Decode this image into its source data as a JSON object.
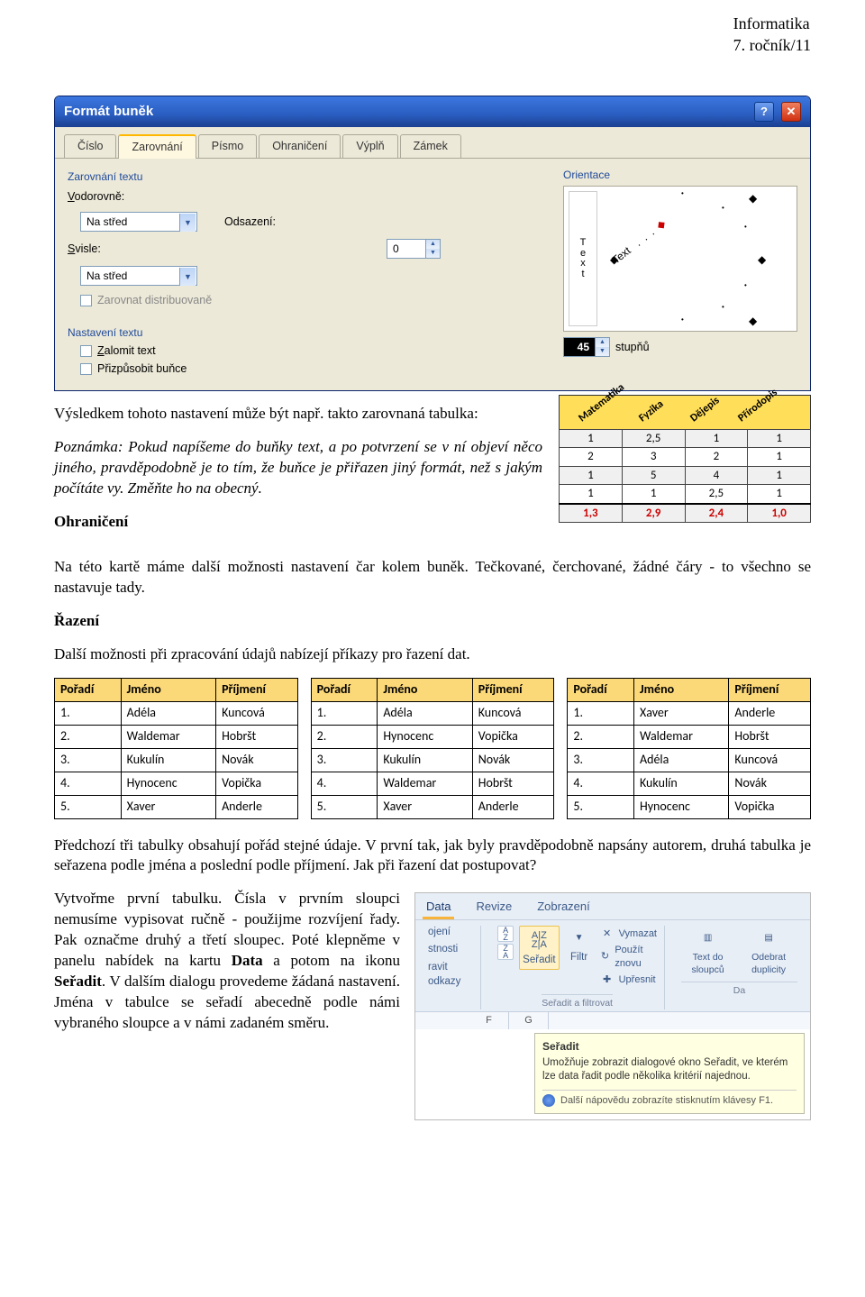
{
  "header": {
    "line1": "Informatika",
    "line2": "7. ročník/11"
  },
  "dialog": {
    "title": "Formát buněk",
    "tabs": [
      "Číslo",
      "Zarovnání",
      "Písmo",
      "Ohraničení",
      "Výplň",
      "Zámek"
    ],
    "active_tab": 1,
    "groups": {
      "align": {
        "title": "Zarovnání textu",
        "horiz_label": "Vodorovně:",
        "horiz_value": "Na střed",
        "indent_label": "Odsazení:",
        "indent_value": "0",
        "vert_label": "Svisle:",
        "vert_value": "Na střed",
        "distrib_label": "Zarovnat distribuovaně"
      },
      "textctl": {
        "title": "Nastavení textu",
        "wrap_label": "Zalomit text",
        "shrink_label": "Přizpůsobit buňce"
      },
      "orient": {
        "title": "Orientace",
        "vtext": "T e x t",
        "dial_label": "Text",
        "degrees": "45",
        "deg_unit": "stupňů"
      }
    }
  },
  "body": {
    "p1a": "Výsledkem tohoto nastavení může být např. takto zarovnaná tabulka:",
    "note_label": "Poznámka:",
    "note": " Pokud napíšeme do buňky text, a po potvrzení se v ní objeví něco jiného, pravděpodobně je to tím, že buňce je přiřazen jiný formát, než s jakým počítáte vy. Změňte ho na obecný.",
    "h_ohraniceni": "Ohraničení",
    "p2": "Na této kartě máme další možnosti nastavení čar kolem buněk. Tečkované, čerchované, žádné čáry - to všechno se nastavuje tady.",
    "h_razeni": "Řazení",
    "p3": "Další možnosti při zpracování údajů nabízejí příkazy pro řazení dat.",
    "p4": "Předchozí tři tabulky obsahují pořád stejné údaje. V první tak, jak byly pravděpodobně napsány autorem, druhá tabulka je seřazena podle jména a poslední podle příjmení. Jak při řazení dat postupovat?",
    "p5a": "Vytvořme první tabulku. Čísla v prvním sloupci nemusíme vypisovat ručně - použijme rozvíjení řady. Pak označme druhý a třetí sloupec. Poté klepněme v panelu nabídek na kartu ",
    "p5b": "Data",
    "p5c": " a potom na ikonu ",
    "p5d": "Seřadit",
    "p5e": ". V dalším dialogu provedeme žádaná nastavení. Jména v tabulce se seřadí abecedně podle námi vybraného sloupce a v námi zadaném směru."
  },
  "grades": {
    "subjects": [
      "Matematika",
      "Fyzika",
      "Dějepis",
      "Přírodopis"
    ],
    "rows": [
      [
        "1",
        "2,5",
        "1",
        "1"
      ],
      [
        "2",
        "3",
        "2",
        "1"
      ],
      [
        "1",
        "5",
        "4",
        "1"
      ],
      [
        "1",
        "1",
        "2,5",
        "1"
      ],
      [
        "1,3",
        "2,9",
        "2,4",
        "1,0"
      ]
    ]
  },
  "names_tables": {
    "headers": [
      "Pořadí",
      "Jméno",
      "Příjmení"
    ],
    "t1": [
      [
        "1.",
        "Adéla",
        "Kuncová"
      ],
      [
        "2.",
        "Waldemar",
        "Hobršt"
      ],
      [
        "3.",
        "Kukulín",
        "Novák"
      ],
      [
        "4.",
        "Hynocenc",
        "Vopička"
      ],
      [
        "5.",
        "Xaver",
        "Anderle"
      ]
    ],
    "t2": [
      [
        "1.",
        "Adéla",
        "Kuncová"
      ],
      [
        "2.",
        "Hynocenc",
        "Vopička"
      ],
      [
        "3.",
        "Kukulín",
        "Novák"
      ],
      [
        "4.",
        "Waldemar",
        "Hobršt"
      ],
      [
        "5.",
        "Xaver",
        "Anderle"
      ]
    ],
    "t3": [
      [
        "1.",
        "Xaver",
        "Anderle"
      ],
      [
        "2.",
        "Waldemar",
        "Hobršt"
      ],
      [
        "3.",
        "Adéla",
        "Kuncová"
      ],
      [
        "4.",
        "Kukulín",
        "Novák"
      ],
      [
        "5.",
        "Hynocenc",
        "Vopička"
      ]
    ]
  },
  "chart_data": {
    "type": "table",
    "title": "Známky podle předmětů (ukázka zarovnané tabulky)",
    "categories": [
      "Matematika",
      "Fyzika",
      "Dějepis",
      "Přírodopis"
    ],
    "rows": [
      [
        1,
        2.5,
        1,
        1
      ],
      [
        2,
        3,
        2,
        1
      ],
      [
        1,
        5,
        4,
        1
      ],
      [
        1,
        1,
        2.5,
        1
      ]
    ],
    "summary": [
      1.3,
      2.9,
      2.4,
      1.0
    ]
  },
  "ribbon": {
    "tabs": [
      "Data",
      "Revize",
      "Zobrazení"
    ],
    "left_items": [
      "ojení",
      "stnosti",
      "ravit odkazy"
    ],
    "sort_small": [
      "A→Z",
      "Z→A"
    ],
    "sort_label": "Seřadit",
    "filter_label": "Filtr",
    "clear_label": "Vymazat",
    "reapply_label": "Použít znovu",
    "advanced_label": "Upřesnit",
    "texttools_label": "Text do sloupců",
    "removedup_label": "Odebrat duplicity",
    "group_label": "Seřadit a filtrovat",
    "right_group_label": "Da",
    "tooltip_title": "Seřadit",
    "tooltip_body": "Umožňuje zobrazit dialogové okno Seřadit, ve kterém lze data řadit podle několika kritérií najednou.",
    "tooltip_foot": "Další nápovědu zobrazíte stisknutím klávesy F1.",
    "sheet_cols": [
      "F",
      "G"
    ]
  }
}
